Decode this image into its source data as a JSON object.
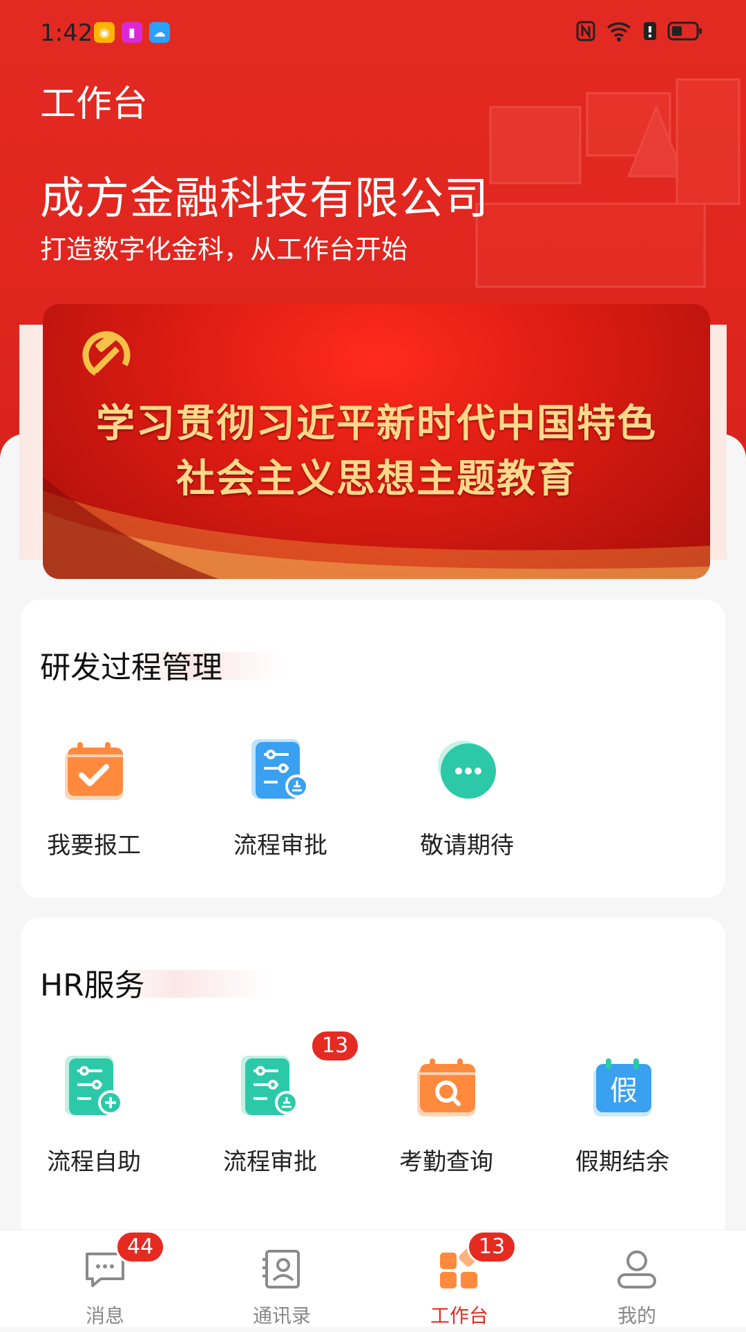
{
  "status_bar": {
    "time": "1:42"
  },
  "header": {
    "title": "工作台",
    "company": "成方金融科技有限公司",
    "slogan": "打造数字化金科，从工作台开始"
  },
  "banner": {
    "line1": "学习贯彻习近平新时代中国特色",
    "line2": "社会主义思想主题教育"
  },
  "sections": [
    {
      "title": "研发过程管理",
      "items": [
        {
          "label": "我要报工",
          "icon": "calendar-check-icon"
        },
        {
          "label": "流程审批",
          "icon": "flow-approval-icon"
        },
        {
          "label": "敬请期待",
          "icon": "more-dots-icon"
        }
      ]
    },
    {
      "title": "HR服务",
      "items": [
        {
          "label": "流程自助",
          "icon": "flow-add-icon"
        },
        {
          "label": "流程审批",
          "icon": "flow-approval-icon",
          "badge": "13"
        },
        {
          "label": "考勤查询",
          "icon": "calendar-search-icon"
        },
        {
          "label": "假期结余",
          "icon": "calendar-holiday-icon",
          "icon_text": "假"
        }
      ]
    }
  ],
  "tabbar": {
    "items": [
      {
        "label": "消息",
        "icon": "message-icon",
        "badge": "44"
      },
      {
        "label": "通讯录",
        "icon": "contacts-icon"
      },
      {
        "label": "工作台",
        "icon": "workbench-icon",
        "badge": "13",
        "active": true
      },
      {
        "label": "我的",
        "icon": "profile-icon"
      }
    ]
  },
  "colors": {
    "primary": "#e52a22",
    "orange": "#ff8a3d",
    "teal": "#2cc9a8",
    "blue": "#3aa0f0"
  }
}
